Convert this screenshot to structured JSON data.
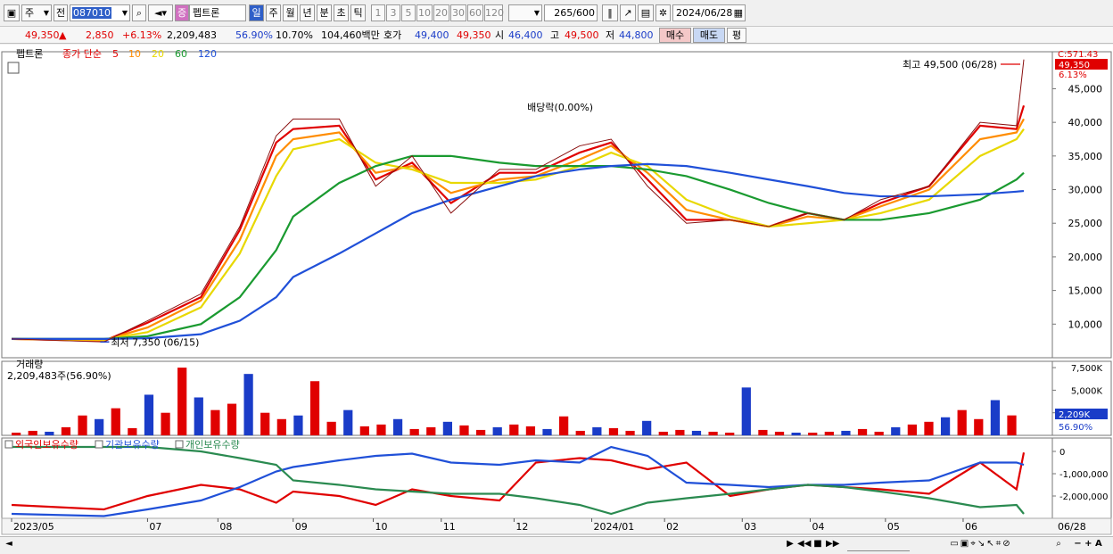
{
  "toolbar": {
    "type_label": "주",
    "prev_label": "전",
    "code": "087010",
    "jeung_badge": "증",
    "name": "펩트론",
    "periods": [
      "일",
      "주",
      "월",
      "년",
      "분",
      "초",
      "틱"
    ],
    "active_period": "일",
    "intervals": [
      "1",
      "3",
      "5",
      "10",
      "20",
      "30",
      "60",
      "120"
    ],
    "count": "265",
    "count_total": "/600",
    "date": "2024/06/28"
  },
  "quote": {
    "price": "49,350",
    "arrow": "▲",
    "change": "2,850",
    "change_pct": "+6.13%",
    "volume": "2,209,483",
    "vol_ratio": "56.90%",
    "turnover": "10.70%",
    "amount": "104,460백만",
    "hoga_label": "호가",
    "ask": "49,400",
    "bid": "49,350",
    "open_label": "시",
    "open": "46,400",
    "high_label": "고",
    "high": "49,500",
    "low_label": "저",
    "low": "44,800",
    "buy_label": "매수",
    "sell_label": "매도",
    "eval_label": "평"
  },
  "chart_data": {
    "type": "line",
    "price_panel": {
      "legend": {
        "name": "펩트론",
        "ma_label": "종가 단순",
        "ma_periods": [
          "5",
          "10",
          "20",
          "60",
          "120"
        ],
        "ma_colors": [
          "#e00000",
          "#ff8c00",
          "#e8d800",
          "#1a9a30",
          "#2050d8"
        ]
      },
      "y_ticks": [
        "45,000",
        "40,000",
        "35,000",
        "30,000",
        "25,000",
        "20,000",
        "15,000",
        "10,000"
      ],
      "y_values": [
        45000,
        40000,
        35000,
        30000,
        25000,
        20000,
        15000,
        10000
      ],
      "ylim": [
        5000,
        50500
      ],
      "header_value": "C:571.43",
      "last_price_label": "49,350",
      "last_change_label": "6.13%",
      "high_annotation": "최고 49,500 (06/28)",
      "low_annotation": "최저 7,350 (06/15)",
      "dividend_annotation": "배당락(0.00%)",
      "price_series": {
        "x": [
          "2023-05-08",
          "2023-06-15",
          "2023-07-03",
          "2023-07-25",
          "2023-08-10",
          "2023-08-25",
          "2023-09-01",
          "2023-09-20",
          "2023-10-05",
          "2023-10-20",
          "2023-11-05",
          "2023-11-25",
          "2023-12-10",
          "2023-12-28",
          "2024-01-10",
          "2024-01-25",
          "2024-02-10",
          "2024-02-28",
          "2024-03-15",
          "2024-03-31",
          "2024-04-15",
          "2024-04-30",
          "2024-05-20",
          "2024-06-10",
          "2024-06-25",
          "2024-06-28"
        ],
        "close": [
          7800,
          7350,
          10500,
          14500,
          24500,
          38000,
          40500,
          40500,
          30500,
          35000,
          26500,
          33000,
          33000,
          36500,
          37500,
          30500,
          25000,
          25500,
          24500,
          26500,
          25500,
          28500,
          30500,
          40000,
          39500,
          49350
        ]
      },
      "ma_series": [
        {
          "name": "5",
          "values": [
            7800,
            7500,
            10200,
            14000,
            24000,
            37000,
            39000,
            39500,
            31500,
            34000,
            28000,
            32500,
            32500,
            35500,
            37000,
            31500,
            25500,
            25500,
            24500,
            26500,
            25500,
            28000,
            30500,
            39500,
            39000,
            42500
          ]
        },
        {
          "name": "10",
          "values": [
            7800,
            7600,
            9500,
            13500,
            22500,
            35000,
            37500,
            38500,
            32500,
            33500,
            29500,
            31500,
            32000,
            34500,
            36500,
            32500,
            27000,
            25500,
            24500,
            26000,
            25500,
            27500,
            30000,
            37500,
            38500,
            40500
          ]
        },
        {
          "name": "20",
          "values": [
            7800,
            7700,
            8800,
            12500,
            20500,
            32000,
            36000,
            37500,
            34000,
            33000,
            31000,
            31000,
            31500,
            33500,
            35500,
            33500,
            28500,
            26000,
            24500,
            25000,
            25500,
            26500,
            28500,
            35000,
            37500,
            39000
          ]
        },
        {
          "name": "60",
          "values": [
            7800,
            7800,
            8200,
            10000,
            14000,
            21000,
            26000,
            31000,
            33500,
            35000,
            35000,
            34000,
            33500,
            33500,
            33500,
            33000,
            32000,
            30000,
            28000,
            26500,
            25500,
            25500,
            26500,
            28500,
            31500,
            32500
          ]
        },
        {
          "name": "120",
          "values": [
            7800,
            7800,
            7900,
            8500,
            10500,
            14000,
            17000,
            20500,
            23500,
            26500,
            28500,
            30500,
            32000,
            33000,
            33500,
            33800,
            33500,
            32500,
            31500,
            30500,
            29500,
            29000,
            29000,
            29300,
            29700,
            29800
          ]
        }
      ]
    },
    "volume_panel": {
      "title": "거래량",
      "value_label": "2,209,483주(56.90%)",
      "y_ticks": [
        "7,500K",
        "5,000K",
        "2,500K"
      ],
      "y_values": [
        7500,
        5000,
        2500
      ],
      "ylim": [
        0,
        8200
      ],
      "last_label": "2,209K",
      "last_sub_label": "56.90%",
      "values_k": [
        300,
        500,
        400,
        900,
        2200,
        1800,
        3000,
        800,
        4500,
        2500,
        7500,
        4200,
        2800,
        3500,
        6800,
        2500,
        1800,
        2200,
        6000,
        1500,
        2800,
        1000,
        1200,
        1800,
        700,
        900,
        1500,
        1100,
        600,
        900,
        1200,
        1000,
        700,
        2100,
        500,
        900,
        800,
        500,
        1600,
        400,
        600,
        500,
        400,
        300,
        5300,
        600,
        400,
        300,
        300,
        400,
        500,
        700,
        400,
        900,
        1200,
        1500,
        2000,
        2800,
        1800,
        3900,
        2209
      ]
    },
    "holdings_panel": {
      "legend": [
        "외국인보유수량",
        "기관보유수량",
        "개인보유수량"
      ],
      "colors": [
        "#e00000",
        "#2050d8",
        "#2a8a50"
      ],
      "y_ticks": [
        "0",
        "-1,000,000",
        "-2,000,000"
      ],
      "y_values": [
        0,
        -1000000,
        -2000000
      ],
      "ylim": [
        -3000000,
        600000
      ],
      "series": [
        {
          "name": "외국인보유수량",
          "values": [
            -2400000,
            -2600000,
            -2000000,
            -1500000,
            -1700000,
            -2300000,
            -1800000,
            -2000000,
            -2400000,
            -1700000,
            -2000000,
            -2200000,
            -500000,
            -300000,
            -400000,
            -800000,
            -500000,
            -2000000,
            -1700000,
            -1500000,
            -1600000,
            -1700000,
            -1900000,
            -500000,
            -1700000,
            -50000
          ]
        },
        {
          "name": "기관보유수량",
          "values": [
            -2800000,
            -2900000,
            -2600000,
            -2200000,
            -1600000,
            -900000,
            -700000,
            -400000,
            -200000,
            -100000,
            -500000,
            -600000,
            -400000,
            -500000,
            200000,
            -200000,
            -1400000,
            -1500000,
            -1600000,
            -1500000,
            -1500000,
            -1400000,
            -1300000,
            -500000,
            -500000,
            -600000
          ]
        },
        {
          "name": "개인보유수량",
          "values": [
            200000,
            200000,
            200000,
            0,
            -300000,
            -600000,
            -1300000,
            -1500000,
            -1700000,
            -1800000,
            -1900000,
            -1900000,
            -2100000,
            -2400000,
            -2800000,
            -2300000,
            -2100000,
            -1900000,
            -1700000,
            -1500000,
            -1600000,
            -1800000,
            -2100000,
            -2500000,
            -2400000,
            -2800000
          ]
        }
      ]
    },
    "x_ticks": [
      "2023/05",
      "07",
      "08",
      "09",
      "10",
      "11",
      "12",
      "2024/01",
      "02",
      "03",
      "04",
      "05",
      "06"
    ],
    "x_end_label": "06/28"
  },
  "navigation": {
    "play_label": "▶",
    "stop_label": "■",
    "zoom_label": "− + A"
  }
}
